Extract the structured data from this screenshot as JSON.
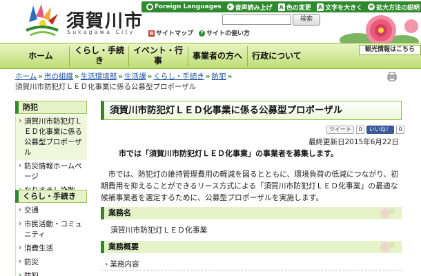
{
  "header": {
    "logo_title": "須賀川市",
    "logo_sub": "Sukagawa City",
    "utility": {
      "foreign_languages": "Foreign Languages",
      "read_aloud": "音声読み上げ",
      "color_change_badge": "A",
      "color_change": "色の変更",
      "text_size_badge": "A",
      "text_size": "文字を大きく",
      "zoom_guide": "拡大方法の説明"
    },
    "search_button": "検索",
    "sitemap": "サイトマップ",
    "site_usage": "サイトの使い方"
  },
  "nav": {
    "home": "ホーム",
    "living": "くらし・手続",
    "living_2": "き",
    "events": "イベント・行",
    "events_2": "事",
    "business": "事業者の方へ",
    "admin": "行政について",
    "tourism": "観光情報はこちら"
  },
  "breadcrumb": {
    "items": [
      "ホーム",
      "市の組織",
      "生活環境部",
      "生活課",
      "くらし・手続き",
      "防犯"
    ],
    "current": "須賀川市防犯灯ＬＥＤ化事業に係る公募型プロポーザル"
  },
  "sidebar": {
    "section1_title": "防犯",
    "section1_items": [
      "須賀川市防犯灯ＬＥＤ化事業に係る公募型プロポーザル",
      "防災情報ホームページ",
      "なりすまし詐欺"
    ],
    "section2_title": "くらし・手続き",
    "section2_items": [
      "交通",
      "市民活動・コミュニティ",
      "消費生活",
      "防災",
      "防犯"
    ]
  },
  "main": {
    "title": "須賀川市防犯灯ＬＥＤ化事業に係る公募型プロポーザル",
    "share": {
      "tweet": "ツイート",
      "tweet_count": "0",
      "like": "いいね！",
      "like_count": "0"
    },
    "updated": "最終更新日2015年6月22日",
    "lead": "市では「須賀川市防犯灯ＬＥＤ化事業」の事業者を募集します。",
    "body": "市では、防犯灯の維持管理費用の軽減を図るとともに、環境負荷の低減につながり、初期費用を抑えることができるリース方式による「須賀川市防犯灯ＬＥＤ化事業」の最適な候補事業者を選定するために、公募型プロポーザルを実施します。",
    "section_business_name": "業務名",
    "business_name": "須賀川市防犯灯ＬＥＤ化事業",
    "section_overview": "業務概要",
    "overview_sub": "業務内容"
  },
  "colors": {
    "brand_green": "#2f8a2f",
    "nav_light": "#e9f5c4",
    "nav_dark": "#bedd74",
    "link_blue": "#1a4fa0",
    "peony_pink": "#e8597a"
  }
}
